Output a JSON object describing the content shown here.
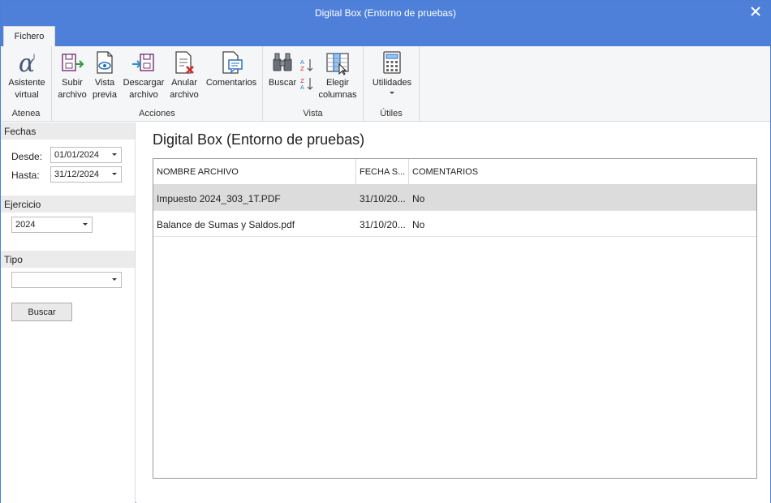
{
  "window": {
    "title": "Digital Box (Entorno de pruebas)"
  },
  "ribbon": {
    "tab_file": "Fichero",
    "groups": [
      {
        "label": "Atenea",
        "buttons": [
          {
            "label": "Asistente virtual",
            "icon": "alpha-icon"
          }
        ]
      },
      {
        "label": "Acciones",
        "buttons": [
          {
            "label": "Subir archivo",
            "icon": "upload-icon"
          },
          {
            "label": "Vista previa",
            "icon": "preview-icon"
          },
          {
            "label": "Descargar archivo",
            "icon": "download-icon"
          },
          {
            "label": "Anular archivo",
            "icon": "cancel-file-icon"
          },
          {
            "label": "Comentarios",
            "icon": "comments-icon"
          }
        ]
      },
      {
        "label": "Vista",
        "buttons": [
          {
            "label": "Buscar",
            "icon": "binoculars-icon"
          },
          {
            "label": "",
            "icon": "sort-asc-icon"
          },
          {
            "label": "",
            "icon": "sort-desc-icon"
          },
          {
            "label": "Elegir columnas",
            "icon": "choose-columns-icon"
          }
        ]
      },
      {
        "label": "Útiles",
        "buttons": [
          {
            "label": "Utilidades",
            "icon": "calculator-icon"
          }
        ]
      }
    ]
  },
  "filters": {
    "fechas": {
      "title": "Fechas",
      "desde_label": "Desde:",
      "desde_value": "01/01/2024",
      "hasta_label": "Hasta:",
      "hasta_value": "31/12/2024"
    },
    "ejercicio": {
      "title": "Ejercicio",
      "value": "2024"
    },
    "tipo": {
      "title": "Tipo",
      "value": ""
    },
    "buscar_label": "Buscar"
  },
  "main": {
    "heading": "Digital Box (Entorno de pruebas)",
    "columns": [
      "NOMBRE ARCHIVO",
      "FECHA S...",
      "COMENTARIOS"
    ],
    "rows": [
      {
        "nombre": "Impuesto 2024_303_1T.PDF",
        "fecha": "31/10/20...",
        "comentarios": "No",
        "selected": true
      },
      {
        "nombre": "Balance de Sumas y Saldos.pdf",
        "fecha": "31/10/20...",
        "comentarios": "No",
        "selected": false
      }
    ]
  },
  "colors": {
    "titlebar": "#4f80d9",
    "ribbon": "#f5f6f7",
    "selected_row": "#dcdcdc",
    "section_bg": "#ebebeb"
  }
}
